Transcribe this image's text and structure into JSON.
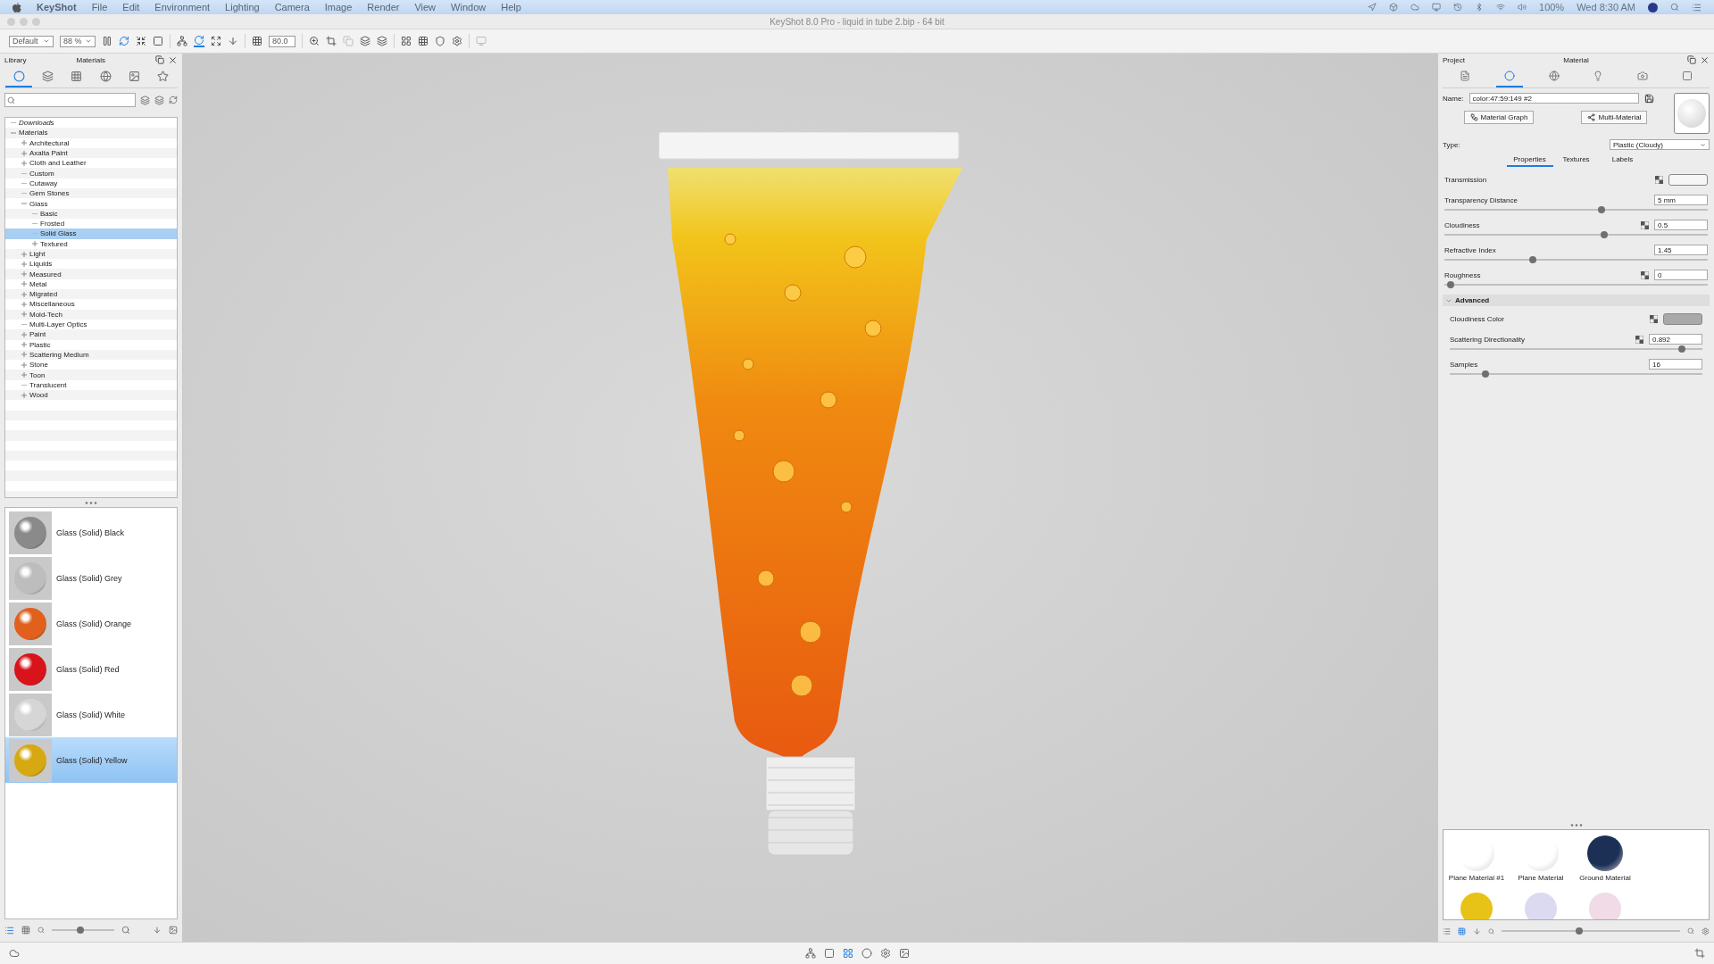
{
  "menu_bar": {
    "app": "KeyShot",
    "items": [
      "File",
      "Edit",
      "Environment",
      "Lighting",
      "Camera",
      "Image",
      "Render",
      "View",
      "Window",
      "Help"
    ],
    "battery": "100%",
    "clock": "Wed 8:30 AM"
  },
  "window": {
    "title": "KeyShot 8.0 Pro  - liquid in tube 2.bip  - 64 bit"
  },
  "toolbar": {
    "preset": "Default",
    "zoom": "88 %",
    "value": "80.0"
  },
  "library": {
    "title": "Library",
    "subtitle": "Materials",
    "tabs": [
      {
        "selected": true
      },
      {
        "selected": false
      },
      {
        "selected": false
      },
      {
        "selected": false
      },
      {
        "selected": false
      },
      {
        "selected": false
      }
    ],
    "tree": [
      {
        "label": "Downloads",
        "italic": true,
        "selected": false
      },
      {
        "label": "Materials",
        "selected": false,
        "expanded": true,
        "children": [
          {
            "label": "Architectural",
            "selected": false,
            "expanded": false
          },
          {
            "label": "Axalta Paint",
            "selected": false,
            "expanded": false
          },
          {
            "label": "Cloth and Leather",
            "selected": false,
            "expanded": false
          },
          {
            "label": "Custom",
            "selected": false
          },
          {
            "label": "Cutaway",
            "selected": false
          },
          {
            "label": "Gem Stones",
            "selected": false
          },
          {
            "label": "Glass",
            "selected": false,
            "expanded": true,
            "children": [
              {
                "label": "Basic",
                "selected": false
              },
              {
                "label": "Frosted",
                "selected": false
              },
              {
                "label": "Solid Glass",
                "selected": true
              },
              {
                "label": "Textured",
                "selected": false,
                "expanded": false
              }
            ]
          },
          {
            "label": "Light",
            "selected": false,
            "expanded": false
          },
          {
            "label": "Liquids",
            "selected": false,
            "expanded": false
          },
          {
            "label": "Measured",
            "selected": false,
            "expanded": false
          },
          {
            "label": "Metal",
            "selected": false,
            "expanded": false
          },
          {
            "label": "Migrated",
            "selected": false,
            "expanded": false
          },
          {
            "label": "Miscellaneous",
            "selected": false,
            "expanded": false
          },
          {
            "label": "Mold-Tech",
            "selected": false,
            "expanded": false
          },
          {
            "label": "Multi-Layer Optics",
            "selected": false
          },
          {
            "label": "Paint",
            "selected": false,
            "expanded": false
          },
          {
            "label": "Plastic",
            "selected": false,
            "expanded": false
          },
          {
            "label": "Scattering Medium",
            "selected": false,
            "expanded": false
          },
          {
            "label": "Stone",
            "selected": false,
            "expanded": false
          },
          {
            "label": "Toon",
            "selected": false,
            "expanded": false
          },
          {
            "label": "Translucent",
            "selected": false
          },
          {
            "label": "Wood",
            "selected": false,
            "expanded": false
          }
        ]
      }
    ],
    "materials": [
      {
        "name": "Glass (Solid) Black",
        "color": "#8a8a8a",
        "selected": false
      },
      {
        "name": "Glass (Solid) Grey",
        "color": "#bdbdbd",
        "selected": false
      },
      {
        "name": "Glass (Solid) Orange",
        "color": "#e0601c",
        "selected": false
      },
      {
        "name": "Glass (Solid) Red",
        "color": "#d8141a",
        "selected": false
      },
      {
        "name": "Glass (Solid) White",
        "color": "#d6d6d6",
        "selected": false
      },
      {
        "name": "Glass (Solid) Yellow",
        "color": "#d6a812",
        "selected": true
      }
    ],
    "size_slider": {
      "level": 0.45
    }
  },
  "material_panel": {
    "title": "Project",
    "subtitle": "Material",
    "tabs": [
      {
        "selected": false
      },
      {
        "selected": true
      },
      {
        "selected": false
      },
      {
        "selected": false
      },
      {
        "selected": false
      },
      {
        "selected": false
      }
    ],
    "name_label": "Name:",
    "name_value": "color:47:59:149 #2",
    "buttons": [
      "Material Graph",
      "Multi-Material"
    ],
    "type_label": "Type:",
    "type_value": "Plastic (Cloudy)",
    "subtabs": [
      {
        "label": "Properties",
        "selected": true
      },
      {
        "label": "Textures",
        "selected": false
      },
      {
        "label": "Labels",
        "selected": false
      }
    ],
    "properties": [
      {
        "kind": "color",
        "label": "Transmission",
        "texture": true,
        "color": "#f6f6f6"
      },
      {
        "kind": "slider",
        "label": "Transparency Distance",
        "value": "5 mm",
        "level": 0.6
      },
      {
        "kind": "slider",
        "label": "Cloudiness",
        "texture": true,
        "value": "0.5",
        "level": 0.61
      },
      {
        "kind": "slider",
        "label": "Refractive Index",
        "value": "1.45",
        "level": 0.33
      },
      {
        "kind": "slider",
        "label": "Roughness",
        "texture": true,
        "value": "0",
        "level": 0.01
      }
    ],
    "advanced": {
      "label": "Advanced",
      "expanded": true,
      "properties": [
        {
          "kind": "color",
          "label": "Cloudiness Color",
          "texture": true,
          "color": "#a9a9a9"
        },
        {
          "kind": "slider",
          "label": "Scattering Directionality",
          "texture": true,
          "value": "0.892",
          "level": 0.93
        },
        {
          "kind": "slider",
          "label": "Samples",
          "value": "16",
          "level": 0.13
        }
      ]
    },
    "project_materials": [
      {
        "name": "Plane Material #1",
        "color": "#ffffff"
      },
      {
        "name": "Plane Material",
        "color": "#ffffff"
      },
      {
        "name": "Ground Material",
        "color": "#1c2f55"
      }
    ],
    "more_materials": [
      {
        "color": "#e8c317"
      },
      {
        "color": "#dcdaf0"
      },
      {
        "color": "#f0dbe6"
      }
    ],
    "size_slider": {
      "level": 0.43
    }
  }
}
